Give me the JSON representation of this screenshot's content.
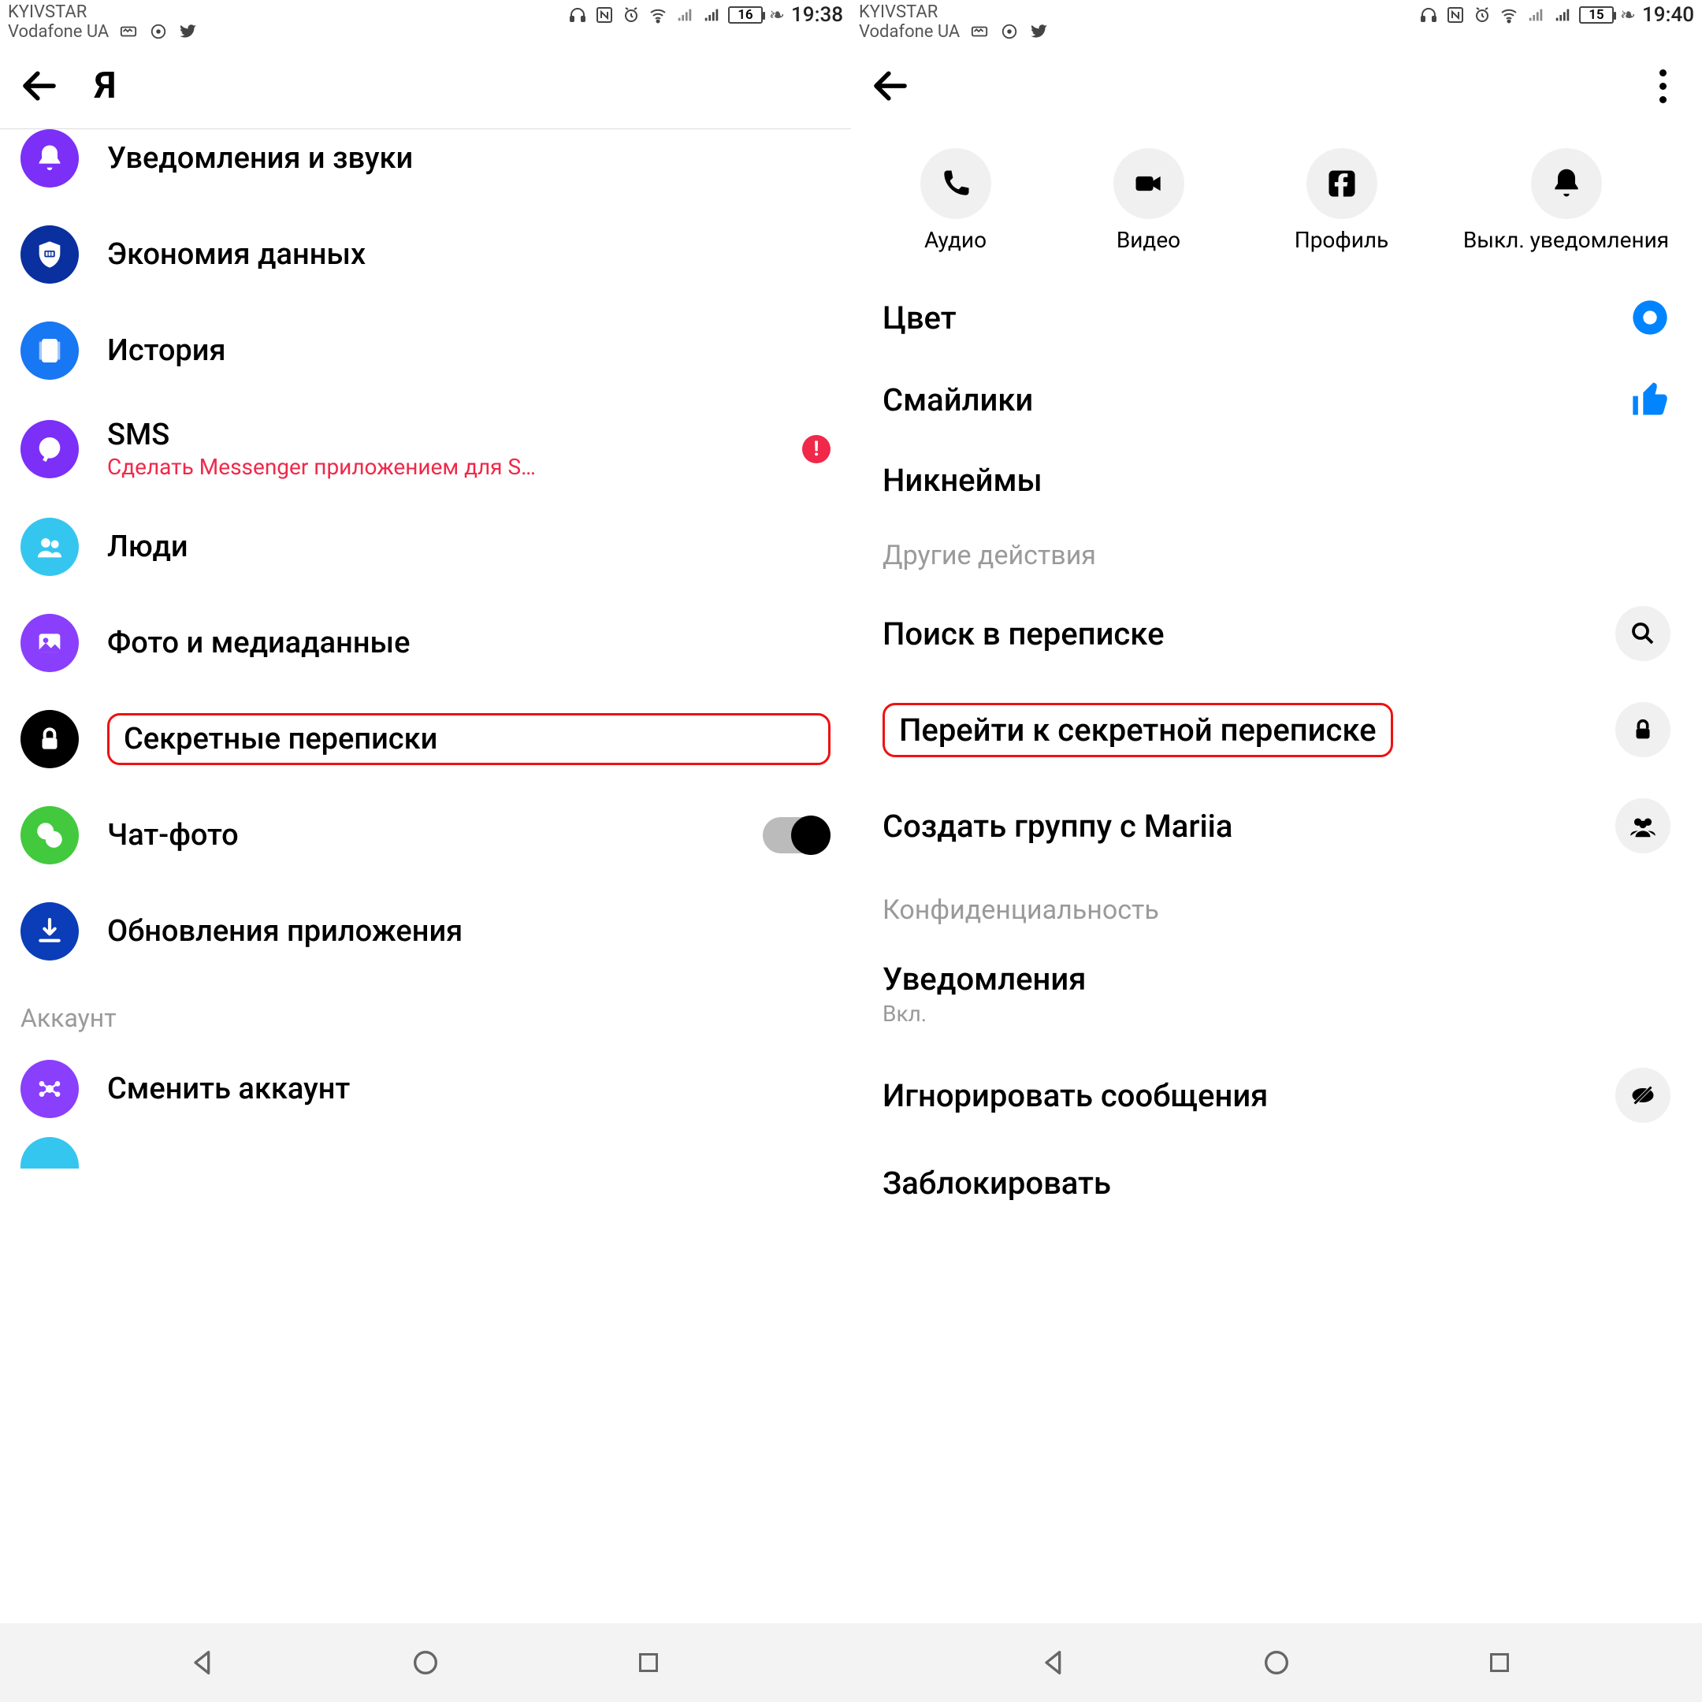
{
  "left": {
    "status": {
      "carrier1": "KYIVSTAR",
      "carrier2": "Vodafone UA",
      "battery": "16",
      "time": "19:38"
    },
    "title": "Я",
    "rows": {
      "notifications": "Уведомления и звуки",
      "data_saver": "Экономия данных",
      "story": "История",
      "sms": "SMS",
      "sms_sub": "Сделать Messenger приложением для S…",
      "people": "Люди",
      "photos": "Фото и медиаданные",
      "secret": "Секретные переписки",
      "chat_photo": "Чат-фото",
      "updates": "Обновления приложения"
    },
    "section_account": "Аккаунт",
    "switch_account": "Сменить аккаунт"
  },
  "right": {
    "status": {
      "carrier1": "KYIVSTAR",
      "carrier2": "Vodafone UA",
      "battery": "15",
      "time": "19:40"
    },
    "actions": {
      "audio": "Аудио",
      "video": "Видео",
      "profile": "Профиль",
      "mute": "Выкл. уведомления"
    },
    "rows": {
      "color": "Цвет",
      "emoji": "Смайлики",
      "nicknames": "Никнеймы"
    },
    "section_other": "Другие действия",
    "search": "Поиск в переписке",
    "secret": "Перейти к секретной переписке",
    "create_group": "Создать группу с Mariia",
    "section_privacy": "Конфиденциальность",
    "notifications": "Уведомления",
    "notifications_sub": "Вкл.",
    "ignore": "Игнорировать сообщения",
    "block": "Заблокировать"
  }
}
